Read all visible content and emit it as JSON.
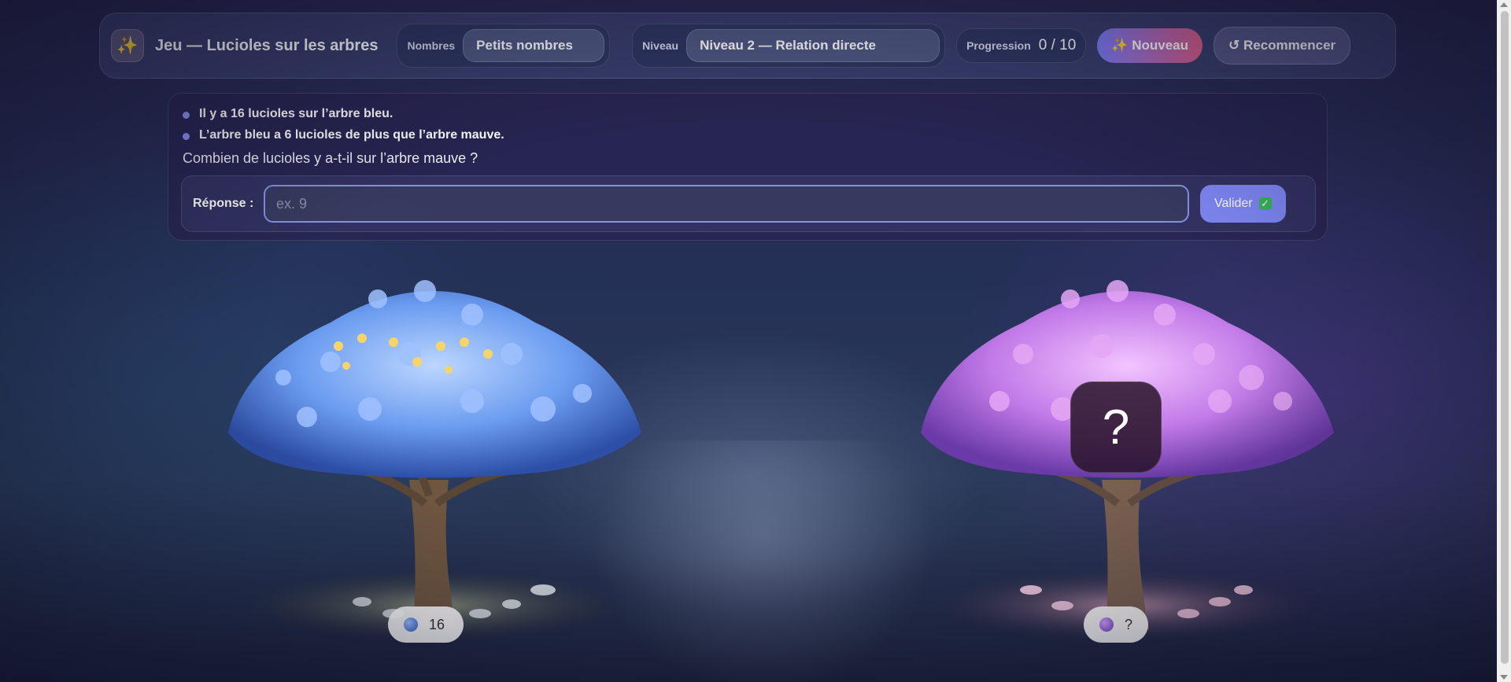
{
  "header": {
    "logo_icon": "sparkles-icon",
    "title": "Jeu — Lucioles sur les arbres",
    "numbers_label": "Nombres",
    "numbers_value": "Petits nombres",
    "level_label": "Niveau",
    "level_value": "Niveau 2 — Relation directe",
    "progress_label": "Progression",
    "progress_value": "0 / 10",
    "new_button": "✨ Nouveau",
    "restart_button": "↺ Recommencer"
  },
  "problem": {
    "facts": [
      "Il y a 16 lucioles sur l’arbre bleu.",
      "L’arbre bleu a 6 lucioles de plus que l’arbre mauve."
    ],
    "question": "Combien de lucioles y a-t-il sur l’arbre mauve ?",
    "answer_label": "Réponse :",
    "answer_placeholder": "ex. 9",
    "answer_value": "",
    "validate_button": "Valider",
    "validate_icon": "check-icon"
  },
  "trees": {
    "left": {
      "color_name": "bleu",
      "count": "16",
      "color": "#5b8ee8"
    },
    "right": {
      "color_name": "mauve",
      "count": "?",
      "color": "#a774e0",
      "mystery": "?"
    }
  }
}
